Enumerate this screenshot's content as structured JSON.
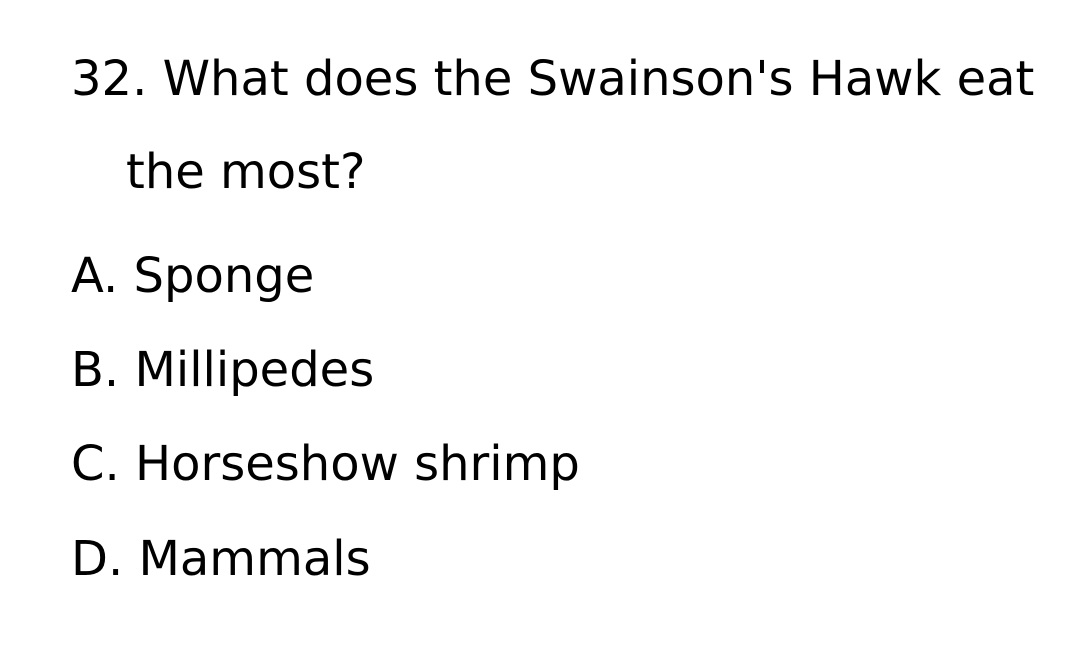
{
  "question": {
    "text": "32. What does the Swainson's Hawk eat the most?"
  },
  "options": [
    {
      "text": "A. Sponge"
    },
    {
      "text": "B. Millipedes"
    },
    {
      "text": "C. Horseshow shrimp"
    },
    {
      "text": "D. Mammals"
    }
  ]
}
